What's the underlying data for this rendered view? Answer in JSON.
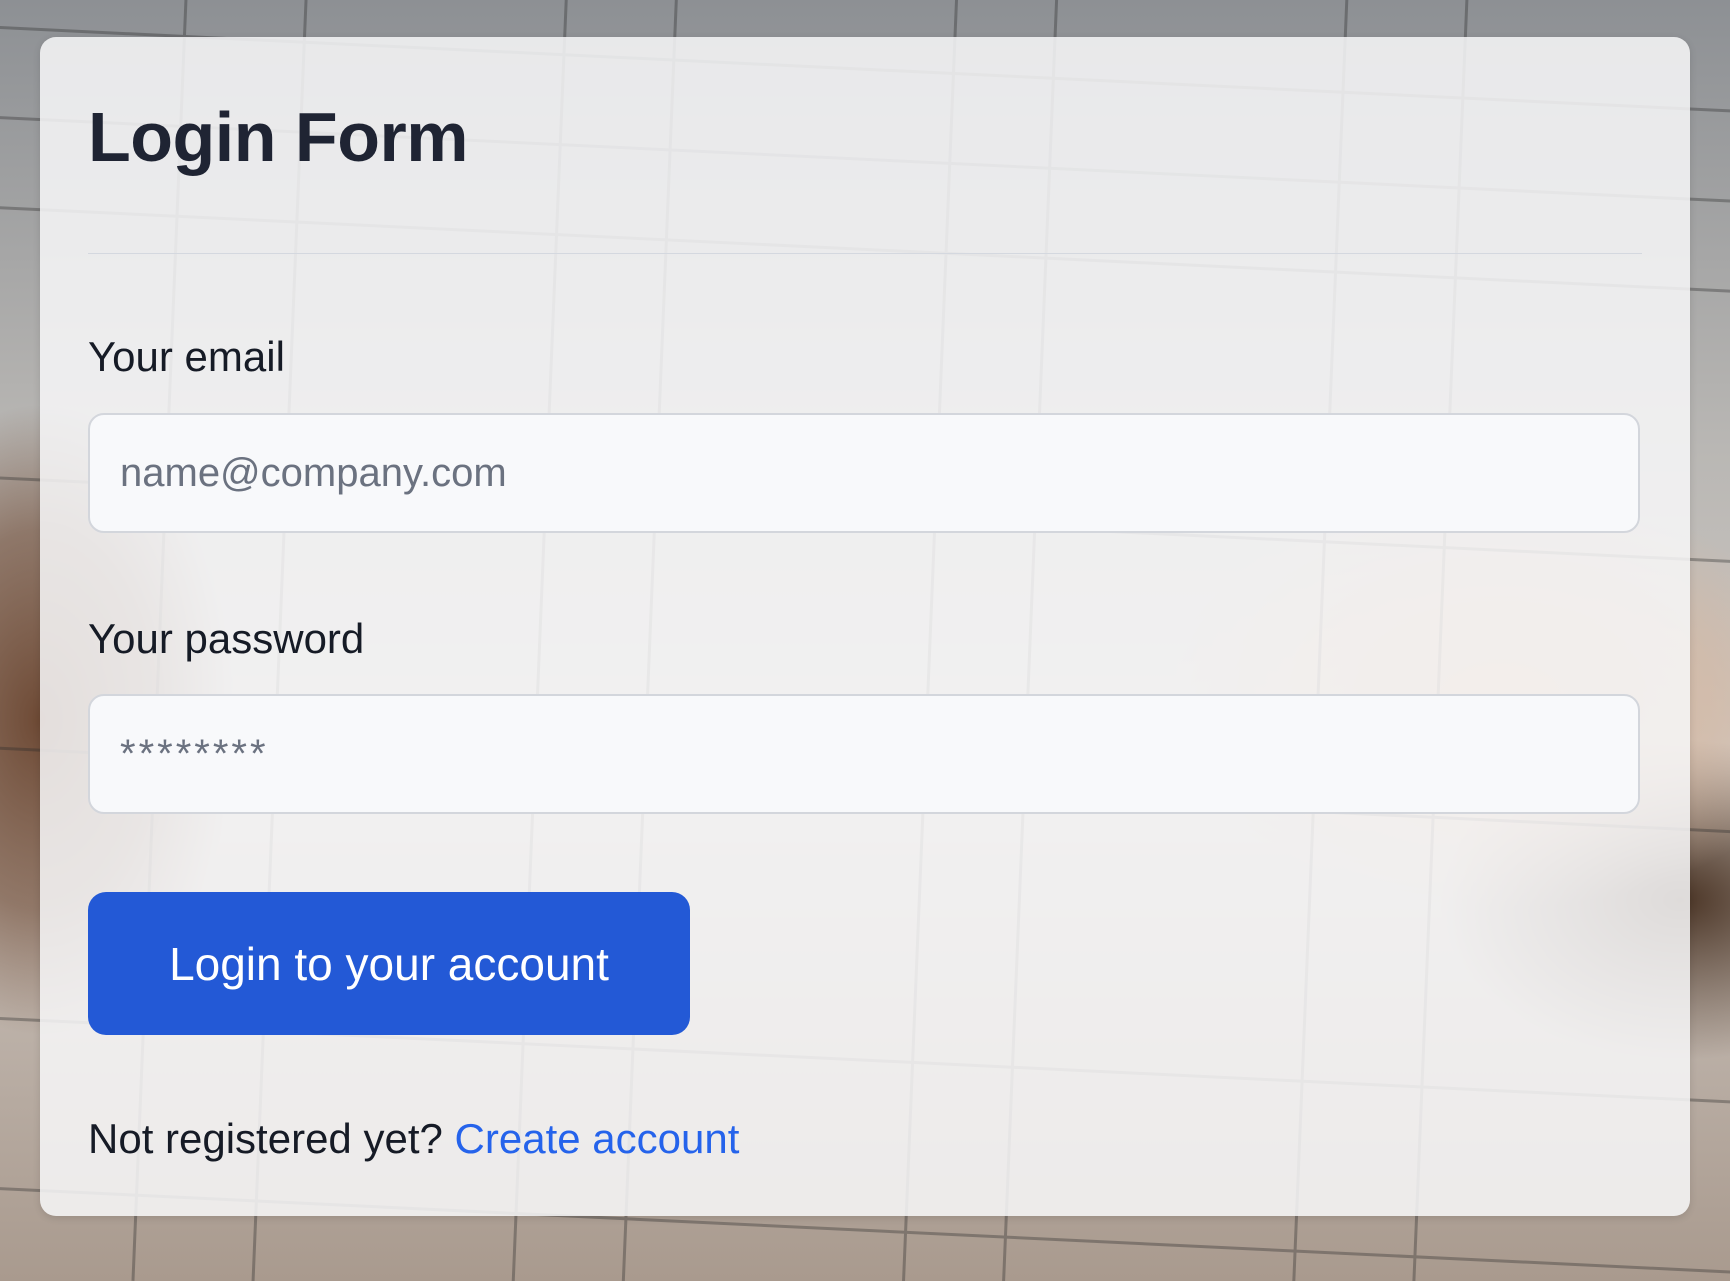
{
  "form": {
    "title": "Login Form",
    "email_label": "Your email",
    "email_placeholder": "name@company.com",
    "password_label": "Your password",
    "password_value": "********",
    "submit_label": "Login to your account",
    "register_prompt": "Not registered yet?",
    "register_link": "Create account"
  },
  "colors": {
    "primary": "#2359d6",
    "link": "#2563eb",
    "text": "#161b26"
  }
}
